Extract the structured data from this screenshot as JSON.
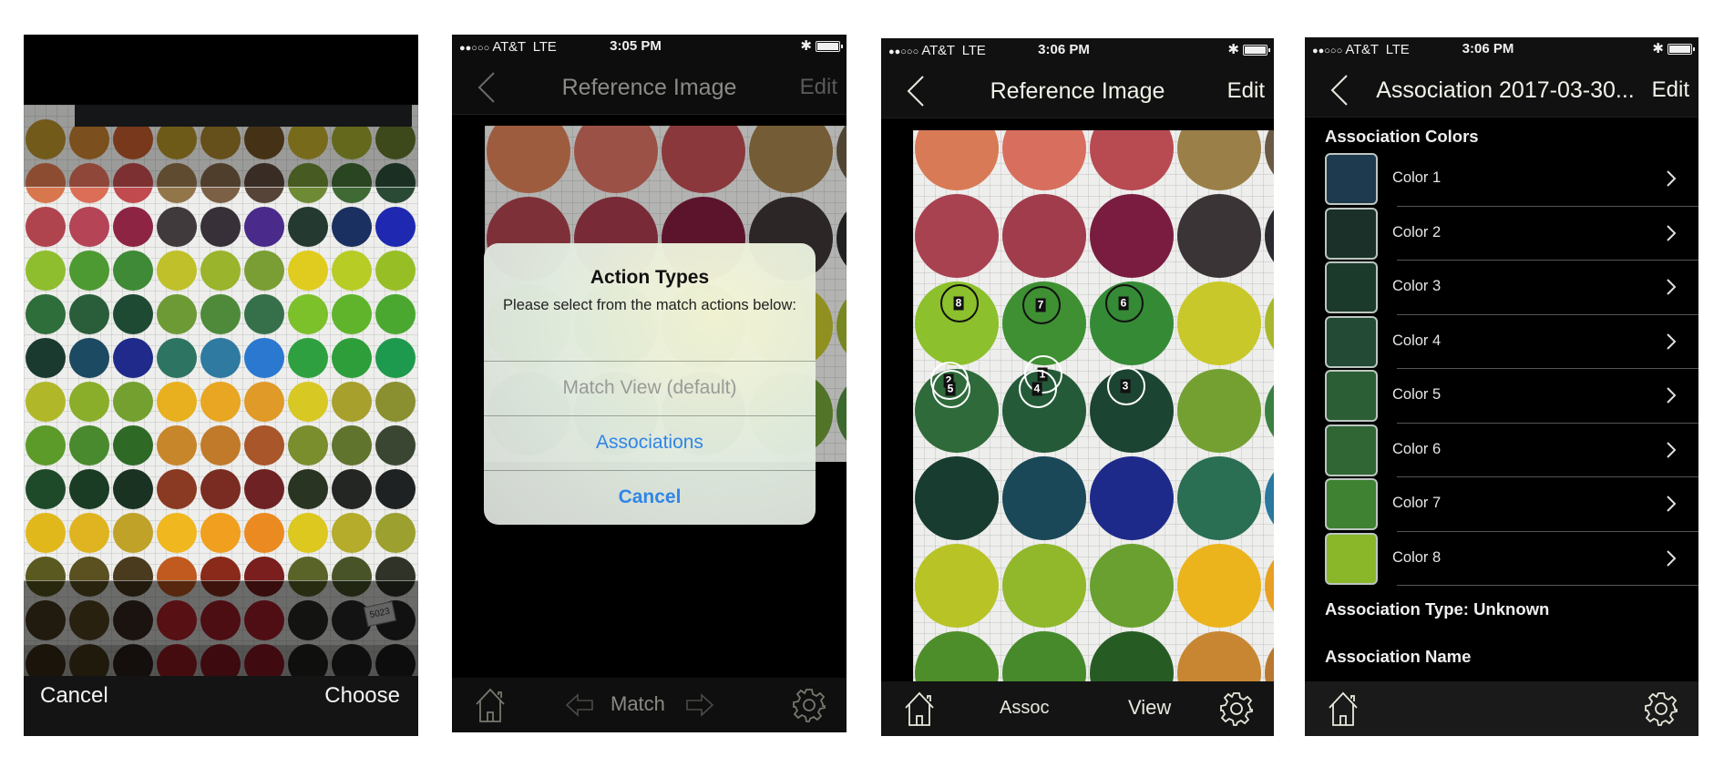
{
  "screens": [
    {
      "id": "photo-picker",
      "actions": {
        "cancel_label": "Cancel",
        "choose_label": "Choose"
      },
      "sample_tag": "5023"
    },
    {
      "id": "reference-image-action-sheet",
      "status": {
        "signal_dots": "●●○○○",
        "carrier": "AT&T",
        "network": "LTE",
        "time": "3:05 PM"
      },
      "nav": {
        "title": "Reference Image",
        "edit_label": "Edit"
      },
      "alert": {
        "title": "Action Types",
        "message": "Please select from the match actions below:",
        "options": [
          {
            "label": "Match View (default)",
            "state": "disabled"
          },
          {
            "label": "Associations",
            "state": "enabled"
          },
          {
            "label": "Cancel",
            "state": "cancel"
          }
        ]
      },
      "toolbar": {
        "center_label": "Match"
      }
    },
    {
      "id": "reference-image-markers",
      "status": {
        "signal_dots": "●●○○○",
        "carrier": "AT&T",
        "network": "LTE",
        "time": "3:06 PM"
      },
      "nav": {
        "title": "Reference Image",
        "edit_label": "Edit"
      },
      "markers": [
        "1",
        "2",
        "3",
        "4",
        "5",
        "6",
        "7",
        "8"
      ],
      "toolbar": {
        "assoc_label": "Assoc",
        "view_label": "View"
      }
    },
    {
      "id": "association-detail",
      "status": {
        "signal_dots": "●●○○○",
        "carrier": "AT&T",
        "network": "LTE",
        "time": "3:06 PM"
      },
      "nav": {
        "title": "Association 2017-03-30...",
        "edit_label": "Edit"
      },
      "colors_heading": "Association Colors",
      "colors": [
        {
          "label": "Color 1",
          "swatch": "#1e3a4e"
        },
        {
          "label": "Color 2",
          "swatch": "#1a3028"
        },
        {
          "label": "Color 3",
          "swatch": "#1c3a2c"
        },
        {
          "label": "Color 4",
          "swatch": "#224a34"
        },
        {
          "label": "Color 5",
          "swatch": "#2b5e35"
        },
        {
          "label": "Color 6",
          "swatch": "#2f6634"
        },
        {
          "label": "Color 7",
          "swatch": "#3e8232"
        },
        {
          "label": "Color 8",
          "swatch": "#8ab62a"
        }
      ],
      "type_label": "Association Type: Unknown",
      "name_label": "Association Name"
    }
  ],
  "theme": {
    "accent_blue": "#2f86e8",
    "bar_dark": "#141414",
    "text_light": "#f2f2ea"
  }
}
